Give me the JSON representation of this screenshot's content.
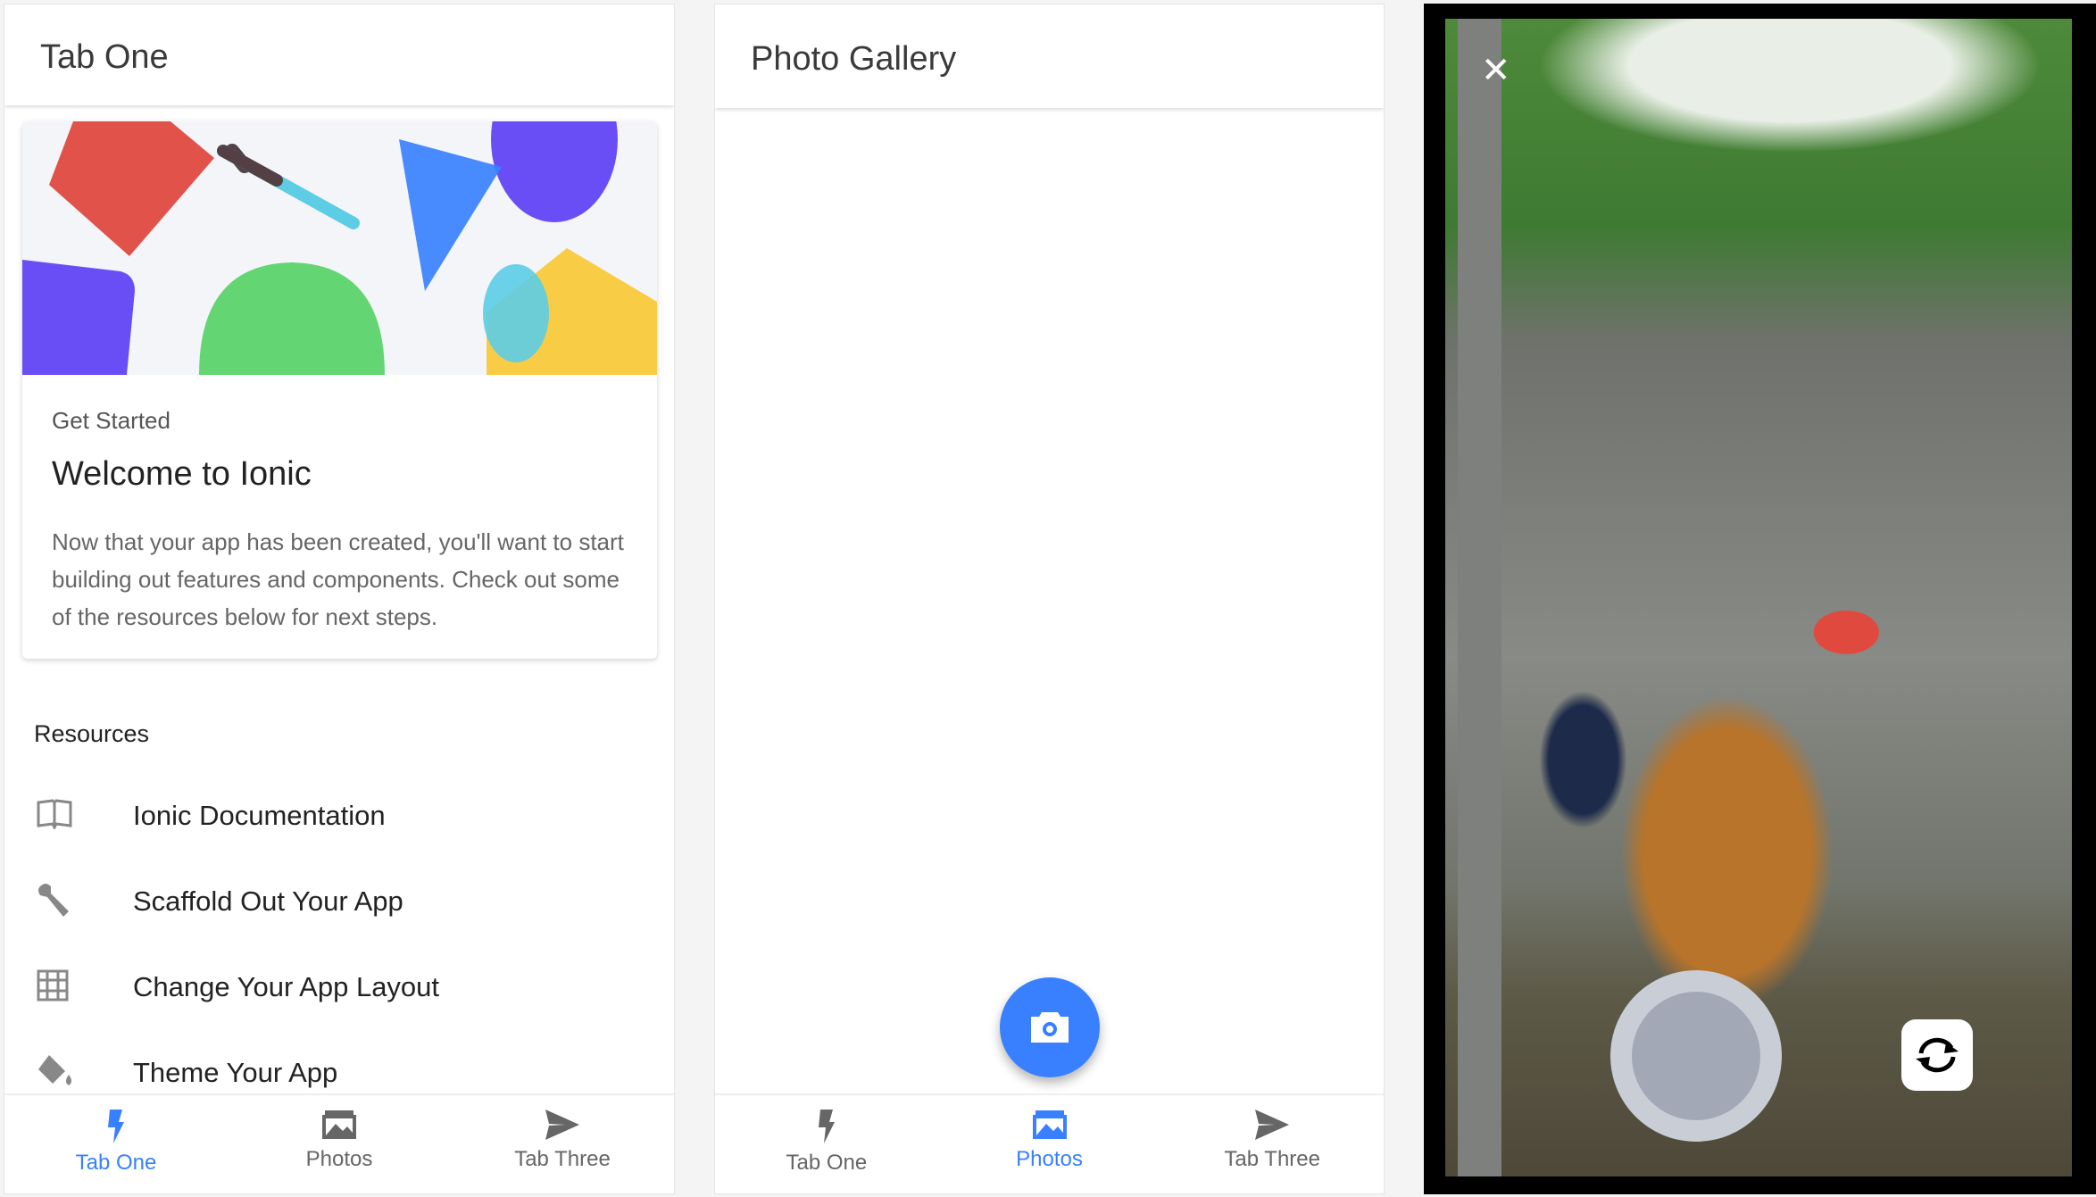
{
  "tab_one": {
    "header_title": "Tab One",
    "card": {
      "subtitle": "Get Started",
      "title": "Welcome to Ionic",
      "body": "Now that your app has been created, you'll want to start building out features and components. Check out some of the resources below for next steps."
    },
    "resources_label": "Resources",
    "resources": [
      {
        "icon": "book-icon",
        "label": "Ionic Documentation"
      },
      {
        "icon": "wrench-icon",
        "label": "Scaffold Out Your App"
      },
      {
        "icon": "grid-icon",
        "label": "Change Your App Layout"
      },
      {
        "icon": "paint-bucket-icon",
        "label": "Theme Your App"
      }
    ]
  },
  "photo_gallery": {
    "header_title": "Photo Gallery",
    "fab_icon": "camera-icon"
  },
  "tabs": [
    {
      "label": "Tab One",
      "icon": "flash-icon"
    },
    {
      "label": "Photos",
      "icon": "images-icon"
    },
    {
      "label": "Tab Three",
      "icon": "send-icon"
    }
  ],
  "camera": {
    "close_icon": "close-icon",
    "flip_icon": "camera-reverse-icon"
  },
  "colors": {
    "accent": "#3880ff",
    "inactive": "#666666"
  }
}
